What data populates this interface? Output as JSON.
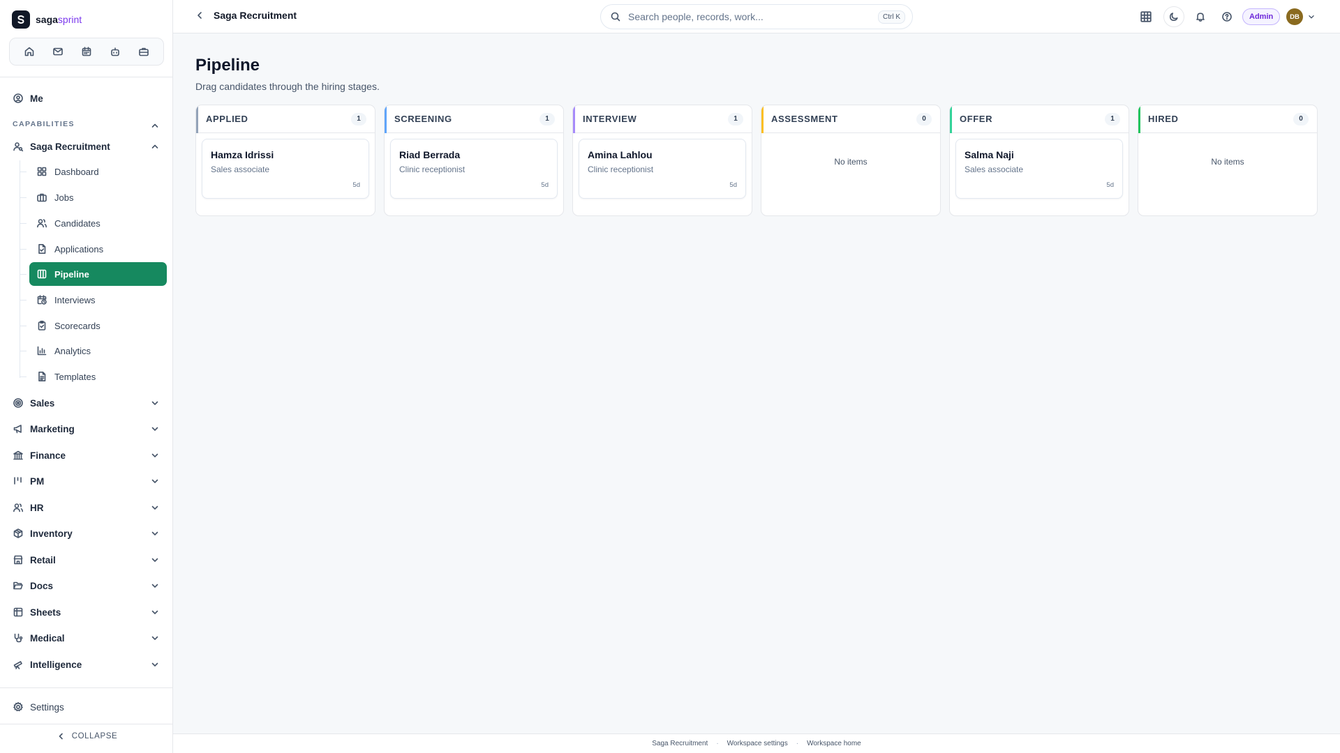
{
  "brand": {
    "name_main": "saga",
    "name_accent": "sprint"
  },
  "sidebar": {
    "me_label": "Me",
    "capabilities_label": "CAPABILITIES",
    "current_group": "Saga Recruitment",
    "sub_items": [
      {
        "label": "Dashboard",
        "icon": "dashboard-icon"
      },
      {
        "label": "Jobs",
        "icon": "briefcase-icon"
      },
      {
        "label": "Candidates",
        "icon": "users-icon"
      },
      {
        "label": "Applications",
        "icon": "file-check-icon"
      },
      {
        "label": "Pipeline",
        "icon": "kanban-icon",
        "active": true
      },
      {
        "label": "Interviews",
        "icon": "calendar-clock-icon"
      },
      {
        "label": "Scorecards",
        "icon": "clipboard-icon"
      },
      {
        "label": "Analytics",
        "icon": "bar-chart-icon"
      },
      {
        "label": "Templates",
        "icon": "document-icon"
      }
    ],
    "groups": [
      {
        "label": "Sales",
        "icon": "target-icon"
      },
      {
        "label": "Marketing",
        "icon": "megaphone-icon"
      },
      {
        "label": "Finance",
        "icon": "bank-icon"
      },
      {
        "label": "PM",
        "icon": "gantt-icon"
      },
      {
        "label": "HR",
        "icon": "users-icon"
      },
      {
        "label": "Inventory",
        "icon": "package-icon"
      },
      {
        "label": "Retail",
        "icon": "store-icon"
      },
      {
        "label": "Docs",
        "icon": "folder-open-icon"
      },
      {
        "label": "Sheets",
        "icon": "table-icon"
      },
      {
        "label": "Medical",
        "icon": "stethoscope-icon"
      },
      {
        "label": "Intelligence",
        "icon": "telescope-icon"
      }
    ],
    "settings_label": "Settings",
    "collapse_label": "COLLAPSE"
  },
  "topbar": {
    "breadcrumb": "Saga Recruitment",
    "search_placeholder": "Search people, records, work...",
    "search_shortcut": "Ctrl K",
    "admin_label": "Admin",
    "avatar_initials": "DB"
  },
  "main": {
    "title": "Pipeline",
    "subtitle": "Drag candidates through the hiring stages."
  },
  "pipeline": {
    "empty_label": "No items",
    "columns": [
      {
        "title": "APPLIED",
        "count": "1",
        "color": "#93a3b8",
        "cards": [
          {
            "name": "Hamza Idrissi",
            "role": "Sales associate",
            "age": "5d"
          }
        ]
      },
      {
        "title": "SCREENING",
        "count": "1",
        "color": "#60a5fa",
        "cards": [
          {
            "name": "Riad Berrada",
            "role": "Clinic receptionist",
            "age": "5d"
          }
        ]
      },
      {
        "title": "INTERVIEW",
        "count": "1",
        "color": "#a78bfa",
        "cards": [
          {
            "name": "Amina Lahlou",
            "role": "Clinic receptionist",
            "age": "5d"
          }
        ]
      },
      {
        "title": "ASSESSMENT",
        "count": "0",
        "color": "#fbbf24",
        "cards": []
      },
      {
        "title": "OFFER",
        "count": "1",
        "color": "#34d399",
        "cards": [
          {
            "name": "Salma Naji",
            "role": "Sales associate",
            "age": "5d"
          }
        ]
      },
      {
        "title": "HIRED",
        "count": "0",
        "color": "#22c55e",
        "cards": []
      }
    ]
  },
  "footer": {
    "links": [
      "Saga Recruitment",
      "Workspace settings",
      "Workspace home"
    ]
  }
}
